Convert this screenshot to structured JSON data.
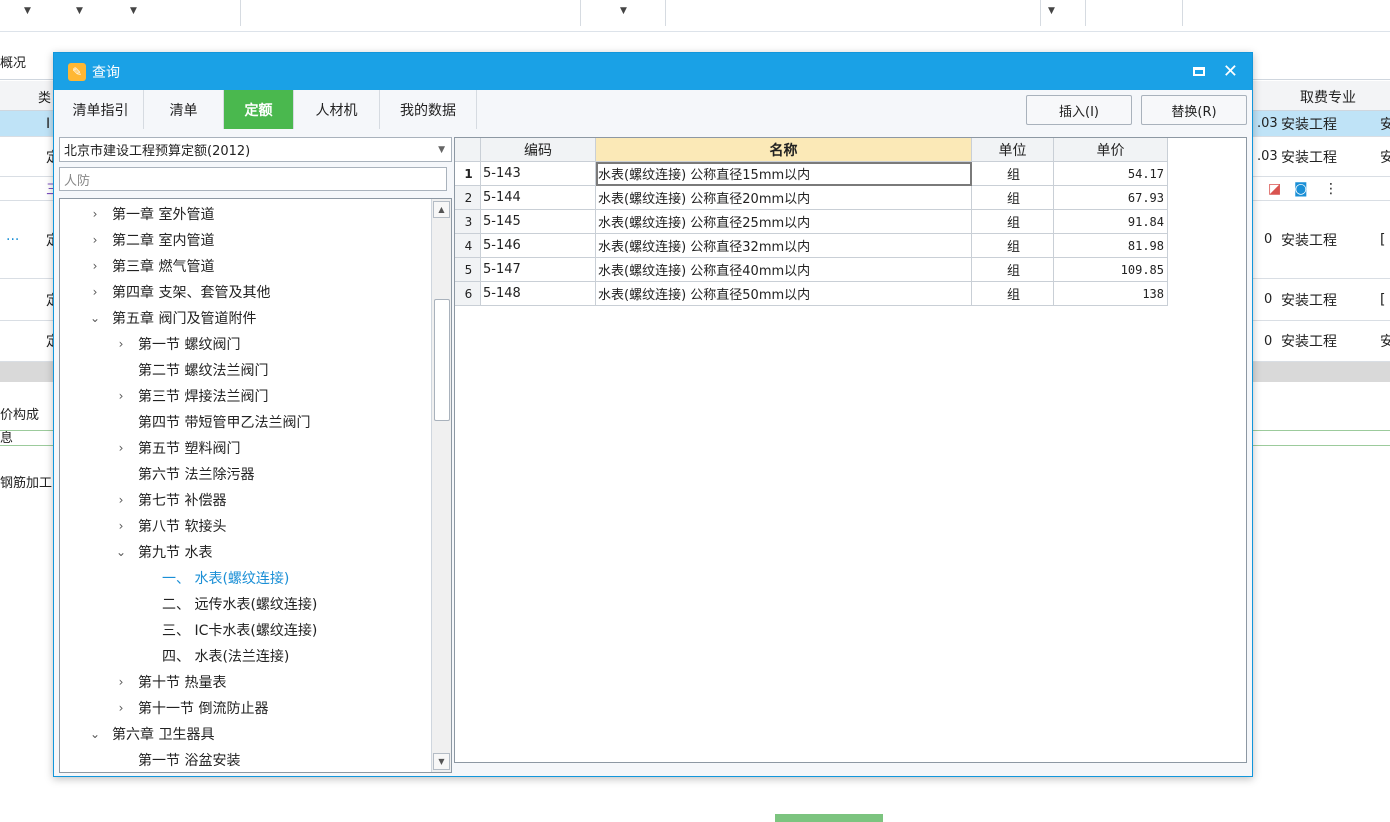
{
  "dialog": {
    "title": "查询",
    "tabs": [
      {
        "label": "清单指引",
        "active": false
      },
      {
        "label": "清单",
        "active": false
      },
      {
        "label": "定额",
        "active": true
      },
      {
        "label": "人材机",
        "active": false
      },
      {
        "label": "我的数据",
        "active": false
      }
    ],
    "insert_label": "插入(I)",
    "replace_label": "替换(R)",
    "quota_library": "北京市建设工程预算定额(2012)",
    "search_value": "人防"
  },
  "tree": [
    {
      "label": "第一章 室外管道",
      "level": 0,
      "arrow": ">"
    },
    {
      "label": "第二章 室内管道",
      "level": 0,
      "arrow": ">"
    },
    {
      "label": "第三章 燃气管道",
      "level": 0,
      "arrow": ">"
    },
    {
      "label": "第四章 支架、套管及其他",
      "level": 0,
      "arrow": ">"
    },
    {
      "label": "第五章 阀门及管道附件",
      "level": 0,
      "arrow": "v"
    },
    {
      "label": "第一节 螺纹阀门",
      "level": 1,
      "arrow": ">"
    },
    {
      "label": "第二节 螺纹法兰阀门",
      "level": 1,
      "arrow": ""
    },
    {
      "label": "第三节 焊接法兰阀门",
      "level": 1,
      "arrow": ">"
    },
    {
      "label": "第四节 带短管甲乙法兰阀门",
      "level": 1,
      "arrow": ""
    },
    {
      "label": "第五节 塑料阀门",
      "level": 1,
      "arrow": ">"
    },
    {
      "label": "第六节 法兰除污器",
      "level": 1,
      "arrow": ""
    },
    {
      "label": "第七节 补偿器",
      "level": 1,
      "arrow": ">"
    },
    {
      "label": "第八节 软接头",
      "level": 1,
      "arrow": ">"
    },
    {
      "label": "第九节 水表",
      "level": 1,
      "arrow": "v"
    },
    {
      "label": "一、 水表(螺纹连接)",
      "level": 2,
      "arrow": "",
      "selected": true
    },
    {
      "label": "二、 远传水表(螺纹连接)",
      "level": 2,
      "arrow": ""
    },
    {
      "label": "三、 IC卡水表(螺纹连接)",
      "level": 2,
      "arrow": ""
    },
    {
      "label": "四、 水表(法兰连接)",
      "level": 2,
      "arrow": ""
    },
    {
      "label": "第十节 热量表",
      "level": 1,
      "arrow": ">"
    },
    {
      "label": "第十一节 倒流防止器",
      "level": 1,
      "arrow": ">"
    },
    {
      "label": "第六章 卫生器具",
      "level": 0,
      "arrow": "v"
    },
    {
      "label": "第一节 浴盆安装",
      "level": 1,
      "arrow": ""
    }
  ],
  "grid": {
    "headers": {
      "code": "编码",
      "name": "名称",
      "unit": "单位",
      "price": "单价"
    },
    "rows": [
      {
        "no": "1",
        "code": "5-143",
        "name": "水表(螺纹连接) 公称直径15mm以内",
        "unit": "组",
        "price": "54.17"
      },
      {
        "no": "2",
        "code": "5-144",
        "name": "水表(螺纹连接) 公称直径20mm以内",
        "unit": "组",
        "price": "67.93"
      },
      {
        "no": "3",
        "code": "5-145",
        "name": "水表(螺纹连接) 公称直径25mm以内",
        "unit": "组",
        "price": "91.84"
      },
      {
        "no": "4",
        "code": "5-146",
        "name": "水表(螺纹连接) 公称直径32mm以内",
        "unit": "组",
        "price": "81.98"
      },
      {
        "no": "5",
        "code": "5-147",
        "name": "水表(螺纹连接) 公称直径40mm以内",
        "unit": "组",
        "price": "109.85"
      },
      {
        "no": "6",
        "code": "5-148",
        "name": "水表(螺纹连接) 公称直径50mm以内",
        "unit": "组",
        "price": "138"
      }
    ]
  },
  "background": {
    "left_labels": [
      "概况",
      "类",
      "I",
      "定",
      "三",
      "定",
      "定",
      "定",
      "价构成",
      "息",
      "钢筋加工"
    ],
    "col_header": "取费专业",
    "rows": [
      {
        "val": ".03",
        "prof": "安装工程",
        "tail": "安"
      },
      {
        "val": ".03",
        "prof": "安装工程",
        "tail": "安"
      },
      {
        "val": "0",
        "prof": "安装工程",
        "tail": "["
      },
      {
        "val": "0",
        "prof": "安装工程",
        "tail": "["
      },
      {
        "val": "0",
        "prof": "安装工程",
        "tail": "安"
      }
    ],
    "ellipsis": "···",
    "colors": {
      "accent": "#1aa1e6",
      "active_tab": "#4ab84e",
      "selected_row": "#bfe3f7",
      "tree_selected": "#1a8fd6"
    }
  }
}
